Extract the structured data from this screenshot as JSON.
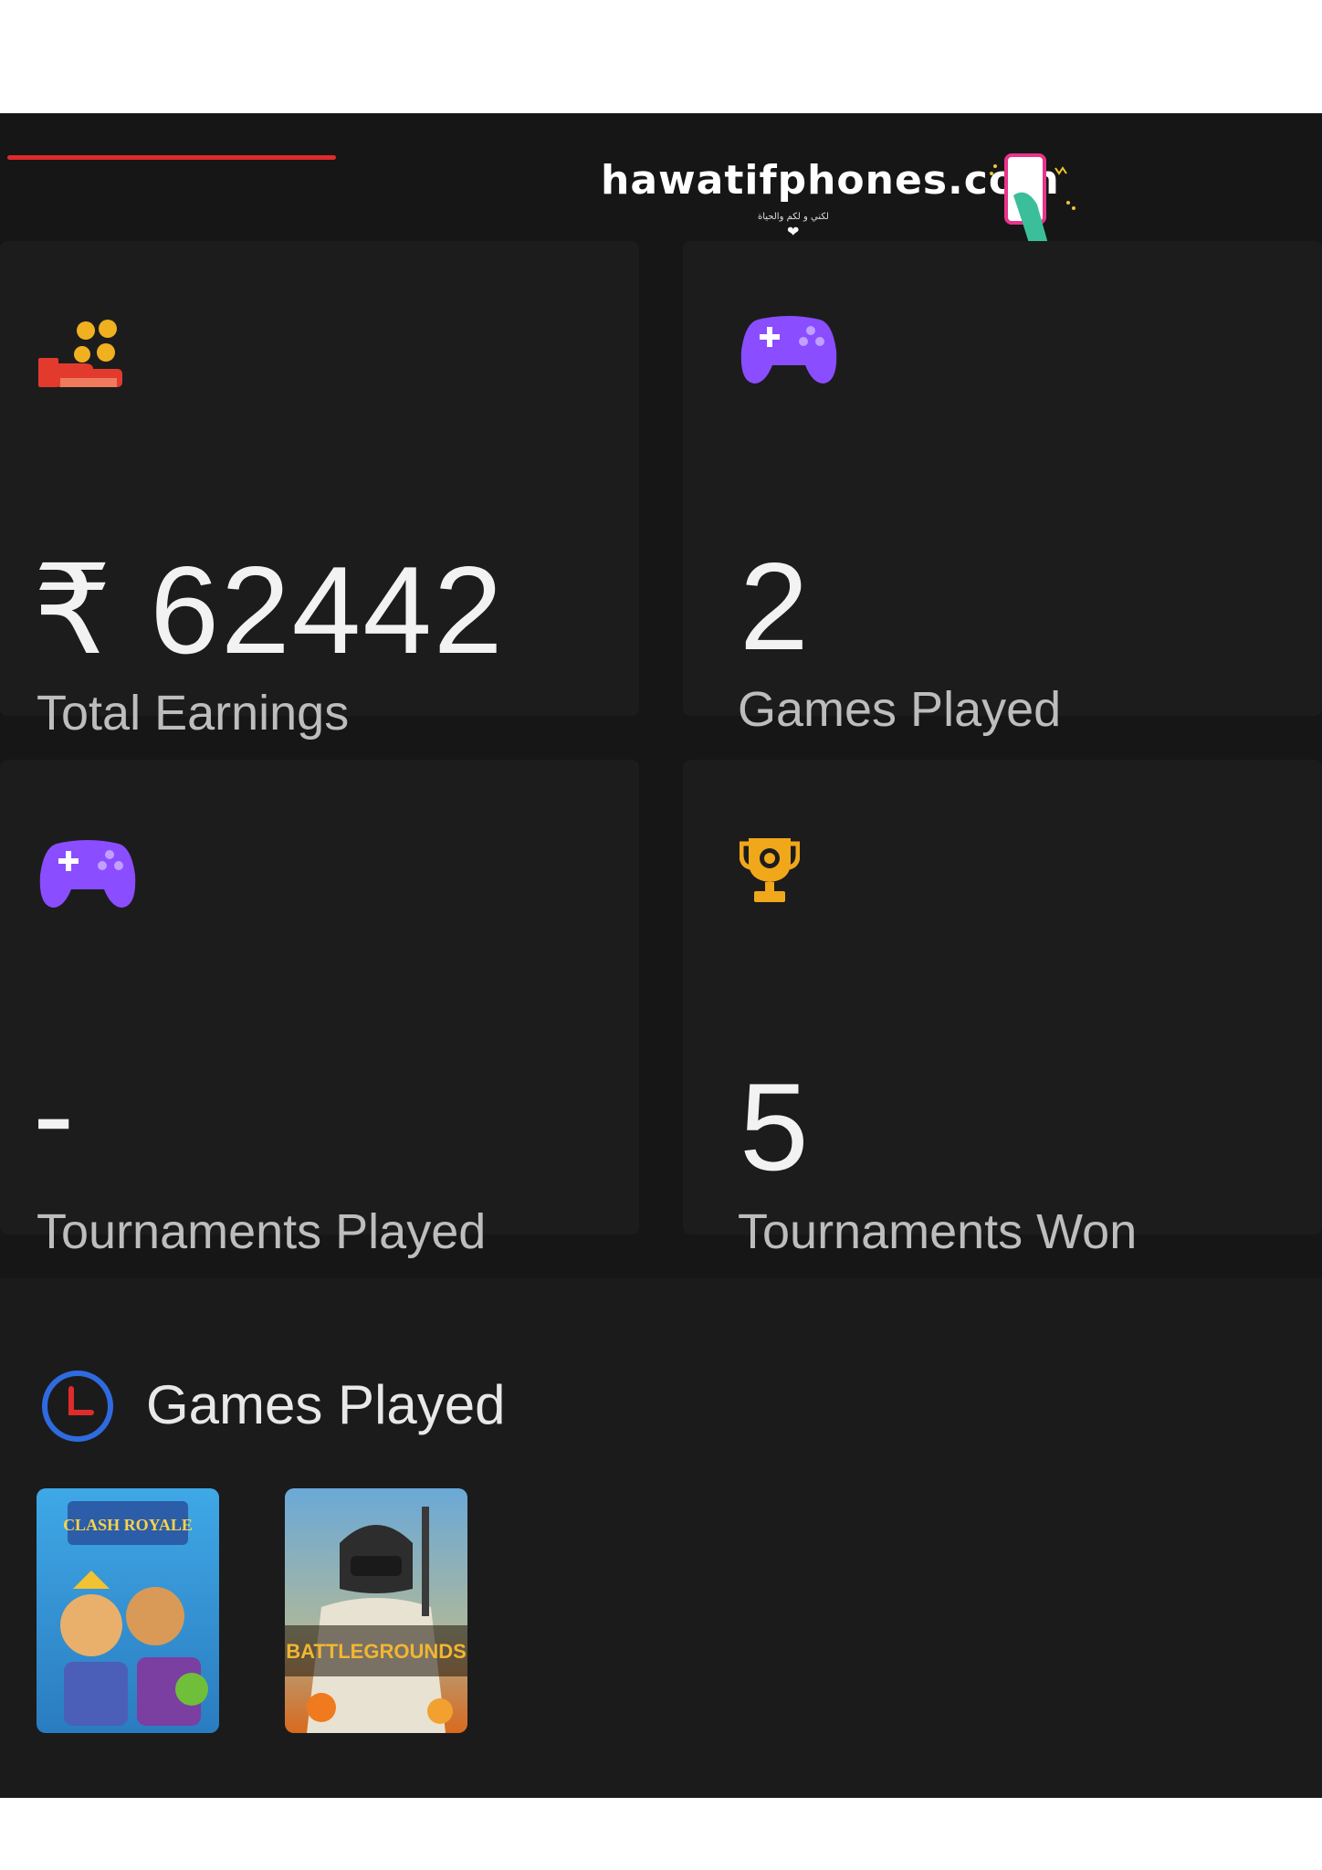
{
  "watermark": {
    "site": "hawatifphones.com",
    "tagline": "لكني و لكم والحياة"
  },
  "stats": [
    {
      "value": "₹ 62442",
      "label": "Total Earnings",
      "icon": "coins-hand-icon"
    },
    {
      "value": "2",
      "label": "Games Played",
      "icon": "gamepad-icon"
    },
    {
      "value": "-",
      "label": "Tournaments Played",
      "icon": "gamepad-icon"
    },
    {
      "value": "5",
      "label": "Tournaments Won",
      "icon": "trophy-icon"
    }
  ],
  "games_section": {
    "title": "Games Played",
    "games": [
      {
        "name": "Clash Royale",
        "logo_text": "CLASH ROYALE"
      },
      {
        "name": "PUBG Battlegrounds",
        "logo_text": "BATTLEGROUNDS"
      }
    ]
  },
  "colors": {
    "background": "#161617",
    "card": "#1c1c1d",
    "accent_red": "#e02b2b",
    "gamepad_purple": "#8a4dff",
    "trophy_gold": "#f0a81a",
    "clock_blue": "#2f6be0"
  }
}
